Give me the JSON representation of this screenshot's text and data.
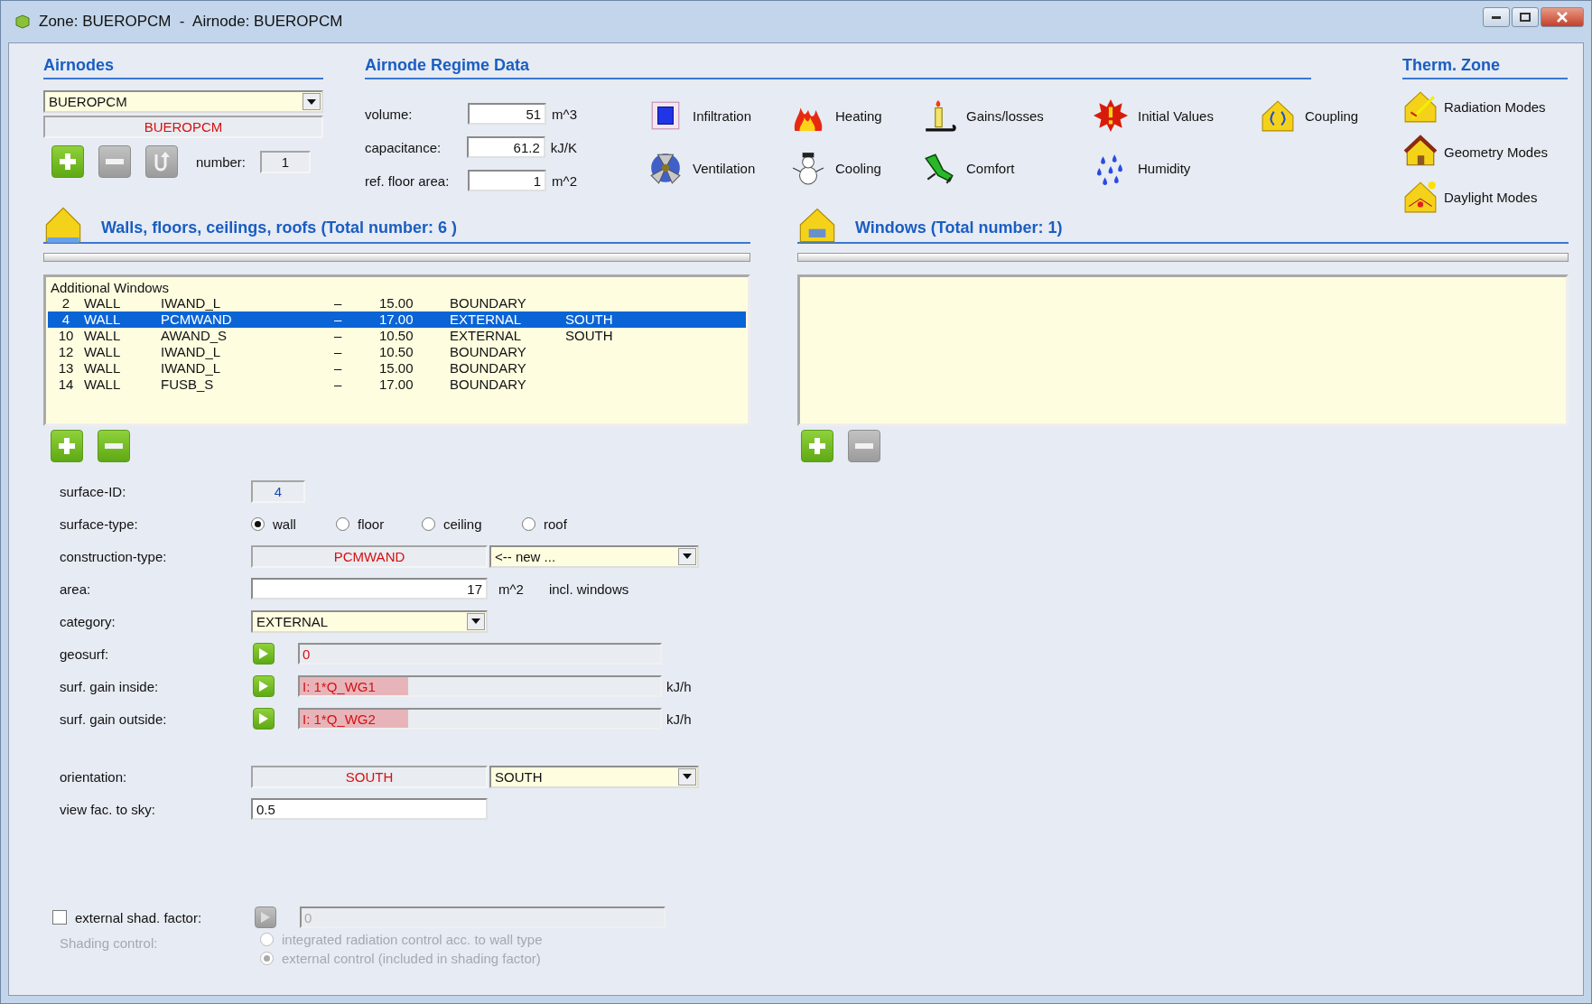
{
  "window": {
    "title": "Zone: BUEROPCM  -  Airnode: BUEROPCM"
  },
  "airnodes": {
    "heading": "Airnodes",
    "selected": "BUEROPCM",
    "name": "BUEROPCM",
    "number_label": "number:",
    "number": "1",
    "buttons": [
      {
        "kind": "add",
        "disabled": false
      },
      {
        "kind": "remove",
        "disabled": true
      },
      {
        "kind": "reset",
        "disabled": true
      }
    ]
  },
  "regime": {
    "heading": "Airnode Regime Data",
    "fields": [
      {
        "label": "volume:",
        "value": "51",
        "unit": "m^3"
      },
      {
        "label": "capacitance:",
        "value": "61.2",
        "unit": "kJ/K"
      },
      {
        "label": "ref. floor area:",
        "value": "1",
        "unit": "m^2"
      }
    ],
    "tools": [
      {
        "kind": "infiltration",
        "label": "Infiltration"
      },
      {
        "kind": "heating",
        "label": "Heating"
      },
      {
        "kind": "gains",
        "label": "Gains/losses"
      },
      {
        "kind": "initial",
        "label": "Initial Values"
      },
      {
        "kind": "coupling",
        "label": "Coupling"
      },
      {
        "kind": "ventilation",
        "label": "Ventilation"
      },
      {
        "kind": "cooling",
        "label": "Cooling"
      },
      {
        "kind": "comfort",
        "label": "Comfort"
      },
      {
        "kind": "humidity",
        "label": "Humidity"
      }
    ]
  },
  "therm_zone": {
    "heading": "Therm. Zone",
    "tools": [
      {
        "kind": "radiation",
        "label": "Radiation Modes"
      },
      {
        "kind": "geometry",
        "label": "Geometry Modes"
      },
      {
        "kind": "daylight",
        "label": "Daylight Modes"
      }
    ]
  },
  "walls": {
    "heading": "Walls, floors, ceilings, roofs (Total number: 6 )",
    "list_title": "Additional Windows",
    "rows": [
      {
        "id": "2",
        "type": "WALL",
        "construction": "IWAND_L",
        "dash": "–",
        "area": "15.00",
        "category": "BOUNDARY",
        "selected": false
      },
      {
        "id": "4",
        "type": "WALL",
        "construction": "PCMWAND",
        "dash": "–",
        "area": "17.00",
        "category": "EXTERNAL",
        "orientation": "SOUTH",
        "selected": true
      },
      {
        "id": "10",
        "type": "WALL",
        "construction": "AWAND_S",
        "dash": "–",
        "area": "10.50",
        "category": "EXTERNAL",
        "orientation": "SOUTH",
        "selected": false
      },
      {
        "id": "12",
        "type": "WALL",
        "construction": "IWAND_L",
        "dash": "–",
        "area": "10.50",
        "category": "BOUNDARY",
        "selected": false
      },
      {
        "id": "13",
        "type": "WALL",
        "construction": "IWAND_L",
        "dash": "–",
        "area": "15.00",
        "category": "BOUNDARY",
        "selected": false
      },
      {
        "id": "14",
        "type": "WALL",
        "construction": "FUSB_S",
        "dash": "–",
        "area": "17.00",
        "category": "BOUNDARY",
        "selected": false
      }
    ],
    "buttons": [
      {
        "kind": "add",
        "disabled": false
      },
      {
        "kind": "remove",
        "disabled": false
      }
    ]
  },
  "windows": {
    "heading": "Windows (Total number: 1)",
    "buttons": [
      {
        "kind": "add",
        "disabled": false
      },
      {
        "kind": "remove",
        "disabled": true
      }
    ]
  },
  "form": {
    "surface_id": {
      "label": "surface-ID:",
      "value": "4"
    },
    "surface_type": {
      "label": "surface-type:",
      "options": [
        {
          "label": "wall",
          "selected": true
        },
        {
          "label": "floor",
          "selected": false
        },
        {
          "label": "ceiling",
          "selected": false
        },
        {
          "label": "roof",
          "selected": false
        }
      ]
    },
    "construction": {
      "label": "construction-type:",
      "value": "PCMWAND",
      "select": "<-- new ..."
    },
    "area": {
      "label": "area:",
      "value": "17",
      "unit": "m^2",
      "note": "incl. windows"
    },
    "category": {
      "label": "category:",
      "value": "EXTERNAL"
    },
    "links": [
      {
        "label": "geosurf:",
        "value": "0",
        "highlighted": false,
        "disabled": false
      },
      {
        "label": "surf. gain inside:",
        "value": "I: 1*Q_WG1",
        "unit": "kJ/h",
        "highlighted": true,
        "disabled": false
      },
      {
        "label": "surf. gain outside:",
        "value": "I: 1*Q_WG2",
        "unit": "kJ/h",
        "highlighted": true,
        "disabled": false
      }
    ],
    "orientation": {
      "label": "orientation:",
      "value": "SOUTH",
      "select": "SOUTH"
    },
    "view_factor": {
      "label": "view fac. to sky:",
      "value": "0.5"
    },
    "shading": {
      "label": "external shad. factor:",
      "checked": false,
      "button_disabled": true,
      "value": "0",
      "control_label": "Shading control:",
      "disabled": true,
      "options": [
        {
          "label": "integrated radiation control acc. to wall type",
          "selected": false
        },
        {
          "label": "external control (included in shading factor)",
          "selected": true
        }
      ]
    }
  }
}
